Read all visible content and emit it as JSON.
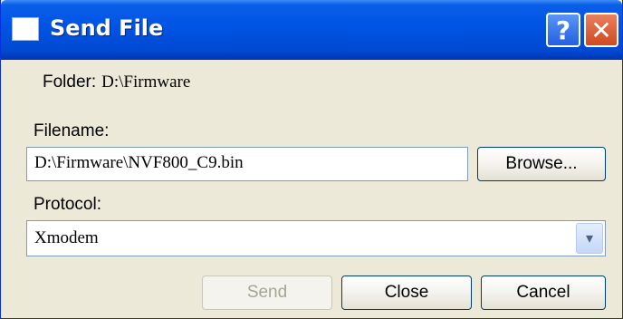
{
  "window": {
    "title": "Send File"
  },
  "titlebar": {
    "help_glyph": "?",
    "close_glyph": "✕"
  },
  "folder": {
    "label": "Folder:",
    "value": "D:\\Firmware"
  },
  "filename": {
    "label": "Filename:",
    "value": "D:\\Firmware\\NVF800_C9.bin"
  },
  "browse_label": "Browse...",
  "protocol": {
    "label": "Protocol:",
    "selected": "Xmodem",
    "arrow_glyph": "▾"
  },
  "buttons": {
    "send": "Send",
    "close": "Close",
    "cancel": "Cancel"
  },
  "icons": {
    "window": "window-icon",
    "help": "help-icon",
    "close": "close-icon",
    "dropdown": "chevron-down-icon"
  }
}
